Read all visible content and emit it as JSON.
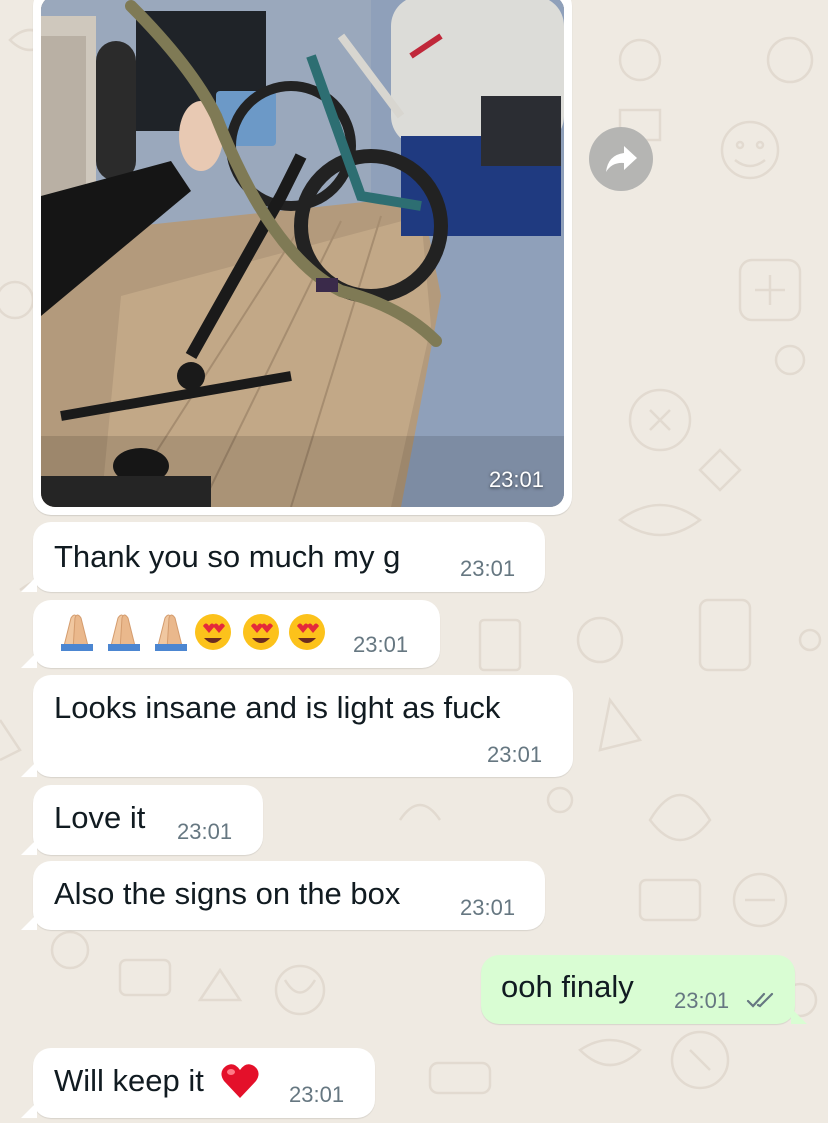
{
  "chat": {
    "image_message": {
      "time": "23:01",
      "forward_icon": "forward-arrow-icon"
    },
    "messages": [
      {
        "text": "Thank you so much my g",
        "time": "23:01",
        "direction": "incoming"
      },
      {
        "emoji": [
          "folded-hands-emoji",
          "folded-hands-emoji",
          "folded-hands-emoji",
          "heart-eyes-emoji",
          "heart-eyes-emoji",
          "heart-eyes-emoji"
        ],
        "time": "23:01",
        "direction": "incoming"
      },
      {
        "text": "Looks insane and is light as fuck",
        "time": "23:01",
        "direction": "incoming"
      },
      {
        "text": "Love it",
        "time": "23:01",
        "direction": "incoming"
      },
      {
        "text": "Also the signs on the box",
        "time": "23:01",
        "direction": "incoming"
      },
      {
        "text": "ooh finaly",
        "time": "23:01",
        "direction": "outgoing",
        "status_icon": "double-check-icon"
      },
      {
        "text": "Will keep it",
        "emoji": "red-heart-emoji",
        "time": "23:01",
        "direction": "incoming"
      }
    ]
  },
  "colors": {
    "background": "#efeae2",
    "incoming_bubble": "#ffffff",
    "outgoing_bubble": "#d9fdd3",
    "timestamp": "#667781",
    "text": "#111b21",
    "forward_button": "#b5b5b3"
  }
}
